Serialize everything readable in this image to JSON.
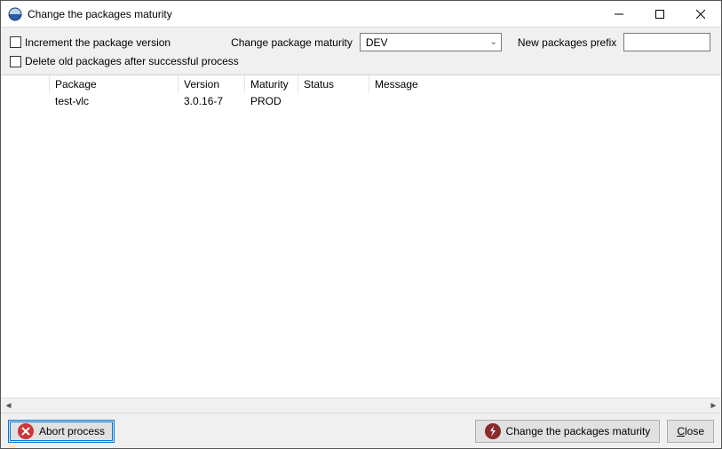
{
  "window": {
    "title": "Change the packages maturity"
  },
  "options": {
    "increment_label": "Increment the package version",
    "delete_label": "Delete old packages after successful process",
    "change_maturity_label": "Change package maturity",
    "maturity_value": "DEV",
    "prefix_label": "New packages prefix",
    "prefix_value": ""
  },
  "table": {
    "headers": {
      "package": "Package",
      "version": "Version",
      "maturity": "Maturity",
      "status": "Status",
      "message": "Message"
    },
    "rows": [
      {
        "package": "test-vlc",
        "version": "3.0.16-7",
        "maturity": "PROD",
        "status": "",
        "message": ""
      }
    ]
  },
  "footer": {
    "abort": "Abort process",
    "change": "Change the packages maturity",
    "close_prefix": "C",
    "close_rest": "lose"
  }
}
